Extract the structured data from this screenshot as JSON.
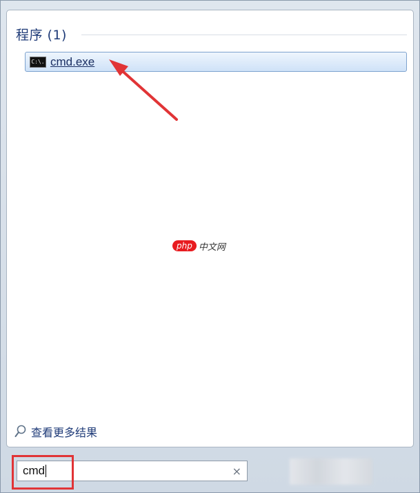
{
  "section": {
    "title": "程序 (1)"
  },
  "results": [
    {
      "label": "cmd.exe",
      "icon_text": "C:\\."
    }
  ],
  "more_results": {
    "label": "查看更多结果"
  },
  "search": {
    "value": "cmd",
    "clear_icon": "×"
  },
  "watermark": {
    "logo": "php",
    "text": "中文网"
  },
  "colors": {
    "highlight_red": "#e13436",
    "result_selected_bg": "#cfe2f8",
    "section_title": "#1f3b78"
  }
}
